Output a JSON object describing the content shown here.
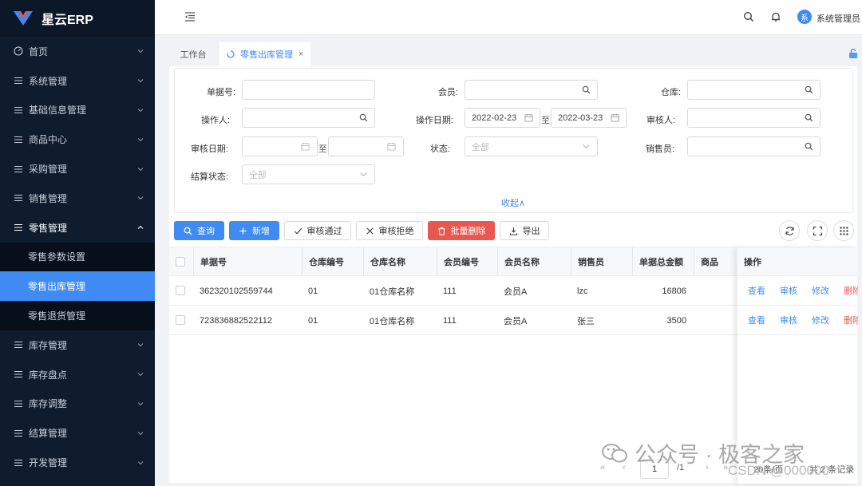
{
  "app": {
    "logo_text": "星云ERP"
  },
  "sidebar": {
    "items": [
      {
        "label": "首页",
        "icon": "dashboard-icon"
      },
      {
        "label": "系统管理",
        "icon": "menu-icon"
      },
      {
        "label": "基础信息管理",
        "icon": "menu-icon"
      },
      {
        "label": "商品中心",
        "icon": "menu-icon"
      },
      {
        "label": "采购管理",
        "icon": "menu-icon"
      },
      {
        "label": "销售管理",
        "icon": "menu-icon"
      },
      {
        "label": "零售管理",
        "icon": "menu-icon",
        "expanded": true
      },
      {
        "label": "库存管理",
        "icon": "menu-icon"
      },
      {
        "label": "库存盘点",
        "icon": "menu-icon"
      },
      {
        "label": "库存调整",
        "icon": "menu-icon"
      },
      {
        "label": "结算管理",
        "icon": "menu-icon"
      },
      {
        "label": "开发管理",
        "icon": "menu-icon"
      }
    ],
    "retail_sub": [
      {
        "label": "零售参数设置",
        "active": false
      },
      {
        "label": "零售出库管理",
        "active": true
      },
      {
        "label": "零售退货管理",
        "active": false
      }
    ]
  },
  "header": {
    "avatar_text": "系",
    "username": "系统管理员"
  },
  "tabs": {
    "workbench": "工作台",
    "retail_out": "零售出库管理",
    "close_glyph": "×"
  },
  "filter": {
    "order_no": {
      "label": "单据号:",
      "value": ""
    },
    "member": {
      "label": "会员:",
      "value": ""
    },
    "warehouse": {
      "label": "仓库:",
      "value": ""
    },
    "operator": {
      "label": "操作人:",
      "value": ""
    },
    "op_date": {
      "label": "操作日期:",
      "start": "2022-02-23",
      "end": "2022-03-23",
      "sep": "至"
    },
    "auditor": {
      "label": "审核人:",
      "value": ""
    },
    "audit_date": {
      "label": "审核日期:",
      "start": "",
      "end": "",
      "sep": "至"
    },
    "status": {
      "label": "状态:",
      "placeholder": "全部"
    },
    "seller": {
      "label": "销售员:",
      "value": ""
    },
    "settle_status": {
      "label": "结算状态:",
      "placeholder": "全部"
    },
    "collapse": "收起∧"
  },
  "toolbar": {
    "query": "查询",
    "add": "新增",
    "approve": "审核通过",
    "reject": "审核拒绝",
    "batch_delete": "批量删除",
    "export": "导出"
  },
  "table": {
    "columns": [
      "单据号",
      "仓库编号",
      "仓库名称",
      "会员编号",
      "会员名称",
      "销售员",
      "单据总金额",
      "商品"
    ],
    "op_header": "操作",
    "rows": [
      {
        "order_no": "362320102559744",
        "wh_code": "01",
        "wh_name": "01仓库名称",
        "member_code": "111",
        "member_name": "会员A",
        "seller": "lzc",
        "amount": "16806"
      },
      {
        "order_no": "723836882522112",
        "wh_code": "01",
        "wh_name": "01仓库名称",
        "member_code": "111",
        "member_name": "会员A",
        "seller": "张三",
        "amount": "3500"
      }
    ],
    "ops": {
      "view": "查看",
      "audit": "审核",
      "edit": "修改",
      "delete": "删除"
    }
  },
  "pagination": {
    "page": "1",
    "total_pages": "/1",
    "page_size": "20条/页",
    "total": "共 2 条记录"
  },
  "watermark": {
    "text": "公众号 · 极客之家",
    "csdn": "CSDN @000000"
  },
  "colors": {
    "primary": "#3f8bf3",
    "danger": "#e8584f",
    "sidebar_bg": "#0f1c2e"
  }
}
